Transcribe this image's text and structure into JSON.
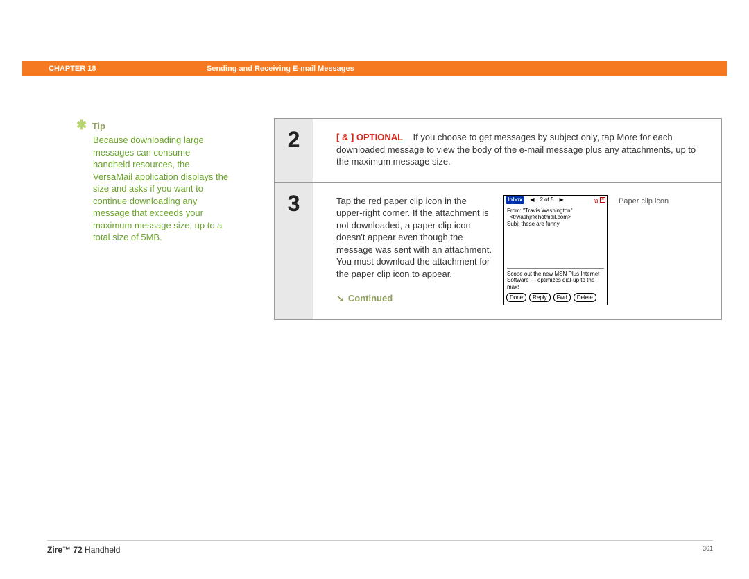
{
  "header": {
    "chapter": "CHAPTER 18",
    "title": "Sending and Receiving E-mail Messages"
  },
  "sidebar": {
    "tip_label": "Tip",
    "tip_body": "Because downloading large messages can consume handheld resources, the VersaMail application displays the size and asks if you want to continue downloading any message that exceeds your maximum message size, up to a total size of 5MB."
  },
  "steps": {
    "s2": {
      "num": "2",
      "optional_tag": "[ & ]  OPTIONAL",
      "text": "If you choose to get messages by subject only, tap More for each downloaded message to view the body of the e-mail message plus any attachments, up to the maximum message size."
    },
    "s3": {
      "num": "3",
      "text": "Tap the red paper clip icon in the upper-right corner. If the attachment is not downloaded, a paper clip icon doesn't appear even though the message was sent with an attachment. You must download the attachment for the paper clip icon to appear.",
      "continued": "Continued"
    }
  },
  "device": {
    "inbox": "Inbox",
    "count": "2 of 5",
    "from_label": "From:",
    "from_name": "\"Travis Washington\"",
    "from_email": "<trwashjr@hotmail.com>",
    "subj_label": "Subj:",
    "subj_text": "these are funny",
    "promo": "Scope out the new MSN Plus Internet Software — optimizes dial-up to the max!",
    "buttons": {
      "done": "Done",
      "reply": "Reply",
      "fwd": "Fwd",
      "delete": "Delete"
    }
  },
  "callout": {
    "paperclip": "Paper clip icon"
  },
  "footer": {
    "product_bold": "Zire™ 72",
    "product_rest": " Handheld",
    "page": "361"
  }
}
